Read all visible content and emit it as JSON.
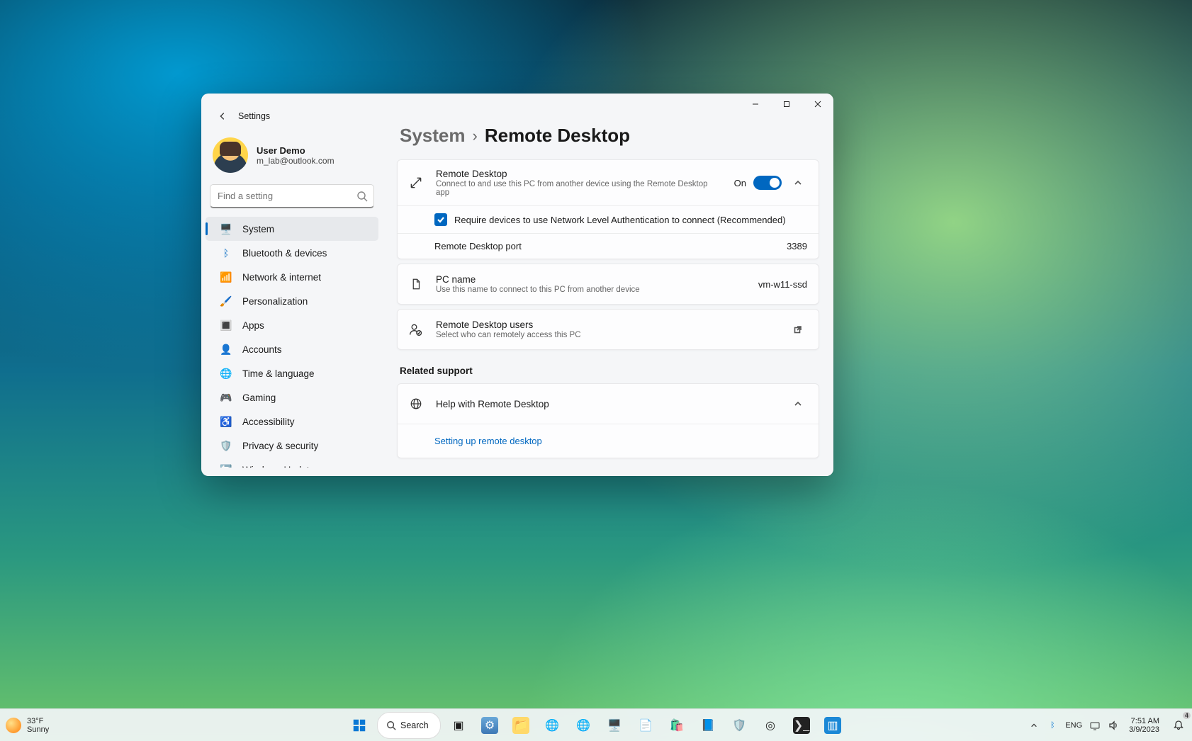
{
  "window": {
    "app_title": "Settings",
    "breadcrumb_root": "System",
    "breadcrumb_leaf": "Remote Desktop"
  },
  "user": {
    "name": "User Demo",
    "email": "m_lab@outlook.com"
  },
  "search": {
    "placeholder": "Find a setting"
  },
  "sidebar": {
    "items": [
      {
        "label": "System",
        "icon": "🖥️",
        "active": true
      },
      {
        "label": "Bluetooth & devices",
        "icon": "ᛒ",
        "icon_color": "#0067c0"
      },
      {
        "label": "Network & internet",
        "icon": "📶"
      },
      {
        "label": "Personalization",
        "icon": "🖌️"
      },
      {
        "label": "Apps",
        "icon": "🔳"
      },
      {
        "label": "Accounts",
        "icon": "👤"
      },
      {
        "label": "Time & language",
        "icon": "🌐"
      },
      {
        "label": "Gaming",
        "icon": "🎮"
      },
      {
        "label": "Accessibility",
        "icon": "♿"
      },
      {
        "label": "Privacy & security",
        "icon": "🛡️"
      },
      {
        "label": "Windows Update",
        "icon": "🔄"
      }
    ]
  },
  "main": {
    "rd": {
      "title": "Remote Desktop",
      "subtitle": "Connect to and use this PC from another device using the Remote Desktop app",
      "toggle_label": "On",
      "nla_label": "Require devices to use Network Level Authentication to connect (Recommended)",
      "port_label": "Remote Desktop port",
      "port_value": "3389"
    },
    "pcname": {
      "title": "PC name",
      "subtitle": "Use this name to connect to this PC from another device",
      "value": "vm-w11-ssd"
    },
    "users": {
      "title": "Remote Desktop users",
      "subtitle": "Select who can remotely access this PC"
    },
    "related_header": "Related support",
    "help": {
      "title": "Help with Remote Desktop",
      "link": "Setting up remote desktop"
    }
  },
  "taskbar": {
    "weather_temp": "33°F",
    "weather_cond": "Sunny",
    "search_label": "Search",
    "lang": "ENG",
    "time": "7:51 AM",
    "date": "3/9/2023",
    "notif_count": "4"
  }
}
